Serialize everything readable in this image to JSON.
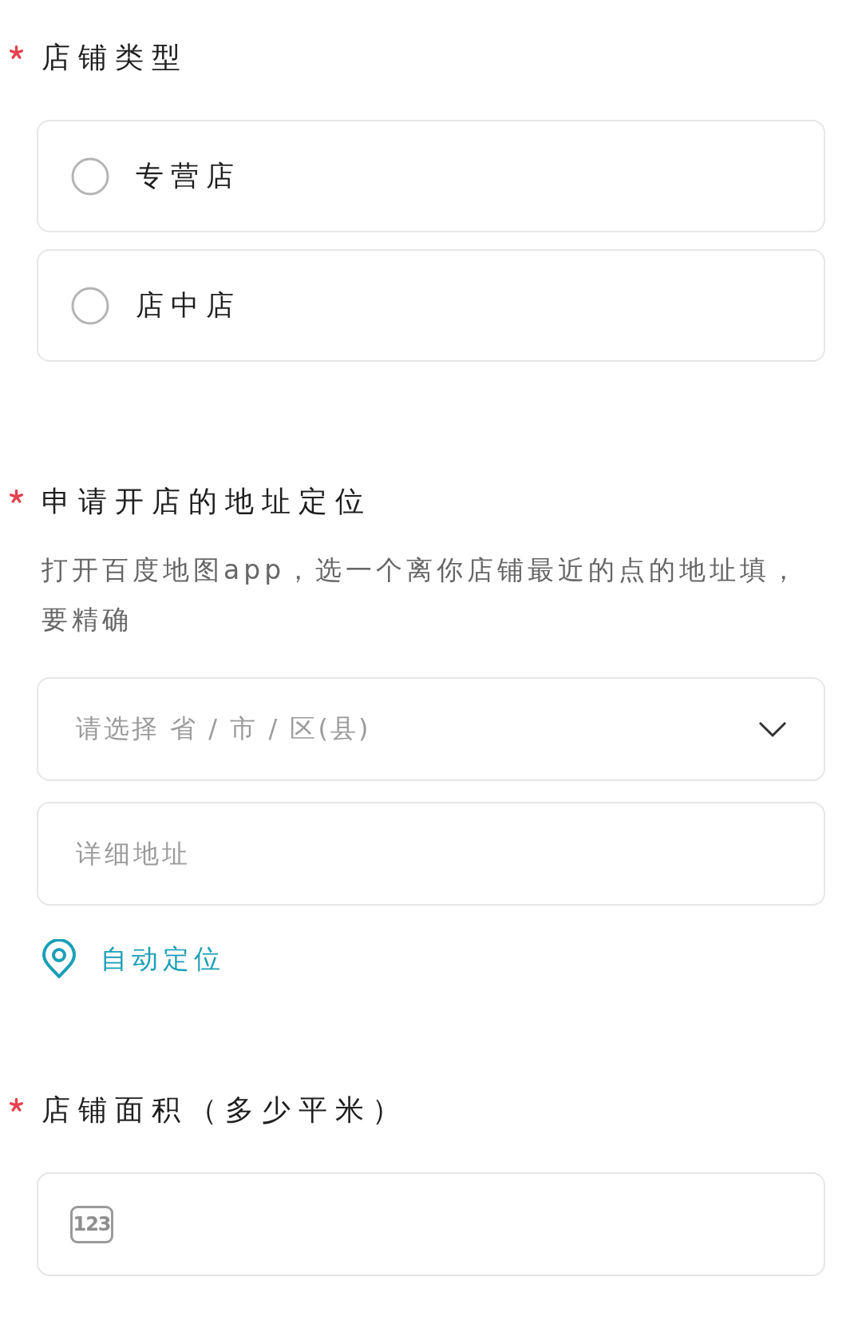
{
  "sections": [
    {
      "kind": "radio_group",
      "required": true,
      "title": "店铺类型",
      "options": [
        {
          "label": "专营店",
          "selected": false
        },
        {
          "label": "店中店",
          "selected": false
        }
      ]
    },
    {
      "kind": "address",
      "required": true,
      "title": "申请开店的地址定位",
      "description": "打开百度地图app，选一个离你店铺最近的点的地址填，要精确",
      "region_select": {
        "placeholder": "请选择 省 / 市 / 区(县)"
      },
      "detail_field": {
        "placeholder": "详细地址"
      },
      "locate_link": "自动定位"
    },
    {
      "kind": "number",
      "required": true,
      "title": "店铺面积（多少平米）",
      "field": {
        "icon_text": "123"
      }
    }
  ]
}
